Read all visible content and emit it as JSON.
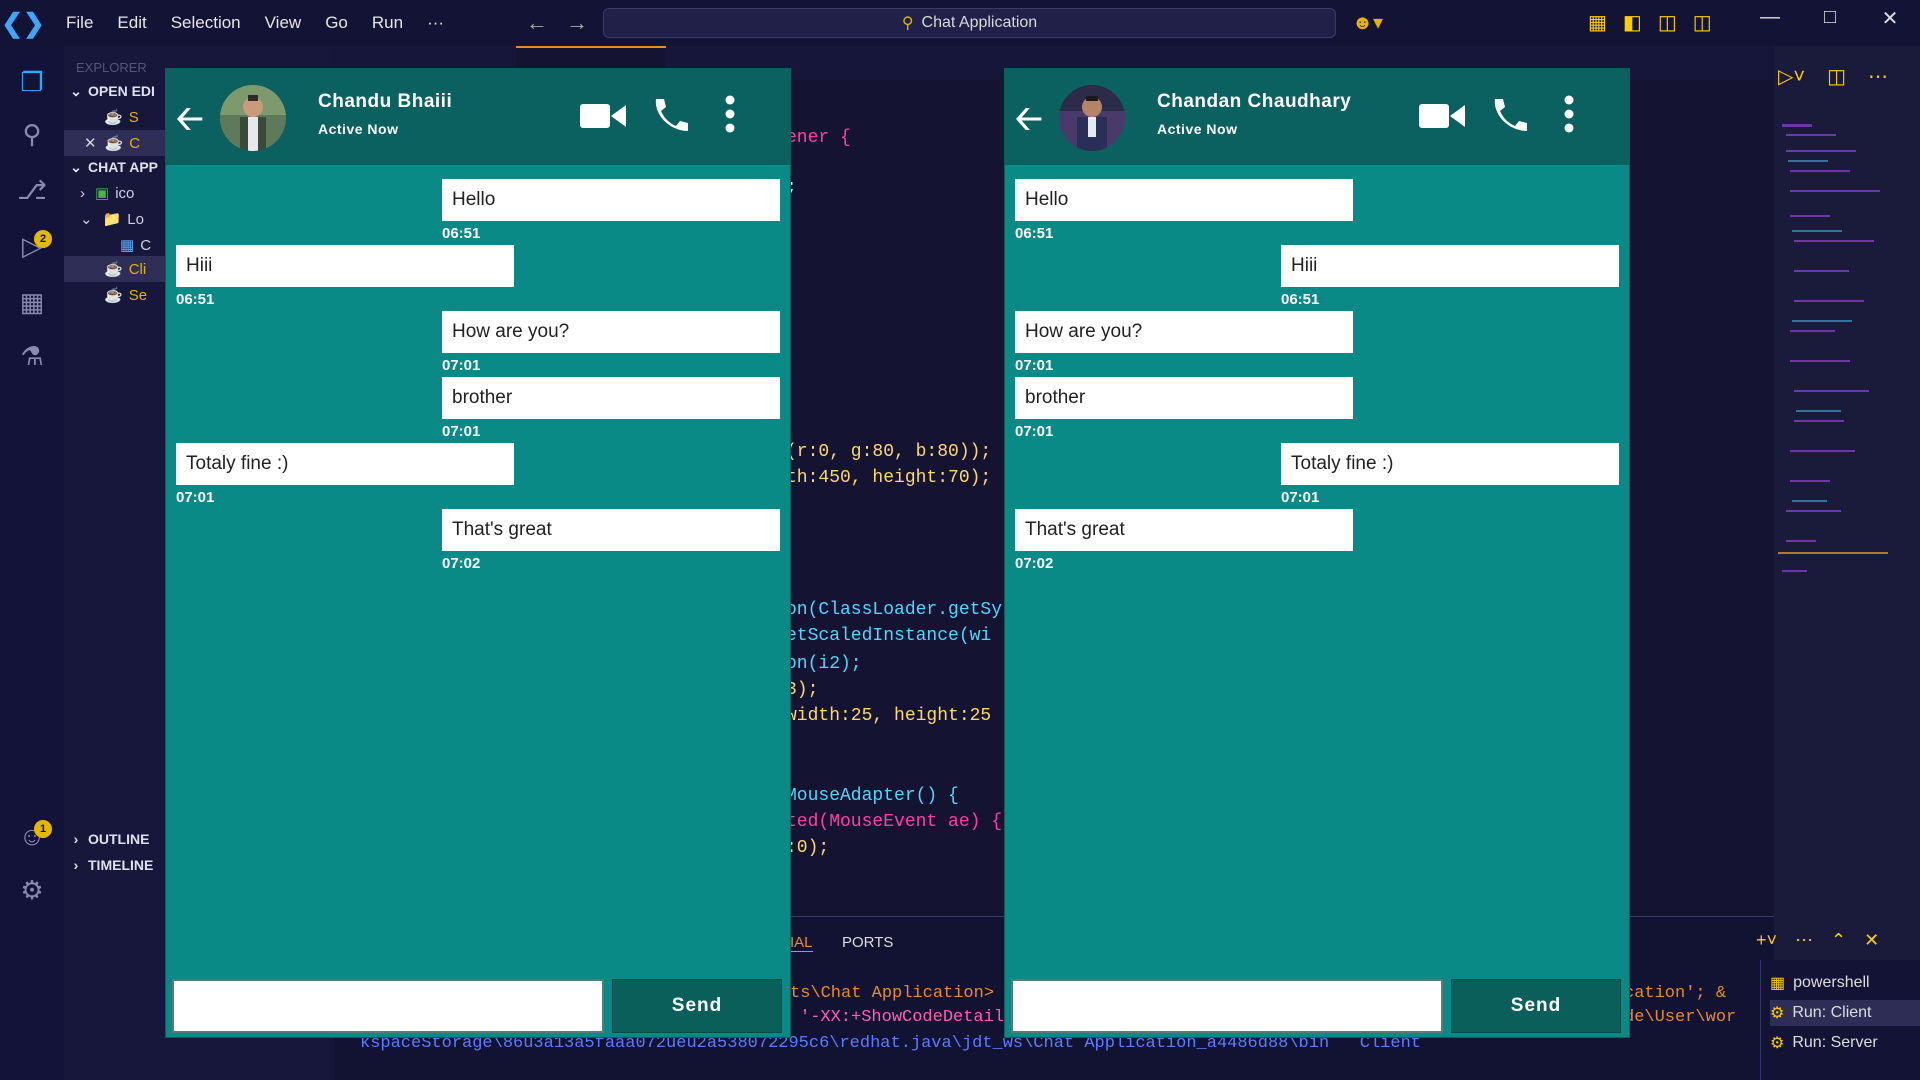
{
  "vscode": {
    "menu": [
      "File",
      "Edit",
      "Selection",
      "View",
      "Go",
      "Run",
      "···"
    ],
    "search_title": "Chat Application",
    "sidebar": {
      "explorer_label": "EXPLORER",
      "open_editors": "OPEN EDI",
      "open_editor_items": [
        "S",
        "C"
      ],
      "project": "CHAT APP",
      "tree_items": [
        "ico",
        "Lo",
        "C",
        "Cli",
        "Se"
      ],
      "outline": "OUTLINE",
      "timeline": "TIMELINE"
    },
    "badges": {
      "run_debug": "2",
      "accounts": "1"
    },
    "code_lines": [
      "ener {",
      ";",
      "(r:0, g:80, b:80));",
      "th:450, height:70);",
      "on(ClassLoader.getSy",
      "etScaledInstance(wi",
      "on(i2);",
      "3);",
      "width:25, height:25",
      "MouseAdapter() {",
      "ted(MouseEvent ae) {",
      ":0);"
    ],
    "panel_tabs": [
      "IAL",
      "PORTS"
    ],
    "terminal_lines": [
      "ts\\Chat Application>",
      "'-XX:+ShowCodeDetail",
      "kspaceStorage\\86u3a13a5faaa072ueu2a538072295c6\\redhat.java\\jdt_ws\\Chat Application_a4486d88\\bin   Client",
      "cation'; &",
      "de\\User\\wor"
    ],
    "terminals": [
      "powershell",
      "Run: Client",
      "Run: Server"
    ]
  },
  "chats": [
    {
      "name": "Chandu Bhaiii",
      "status": "Active Now",
      "send_label": "Send",
      "input_value": "",
      "messages": [
        {
          "text": "Hello",
          "time": "06:51",
          "side": "right"
        },
        {
          "text": "Hiii",
          "time": "06:51",
          "side": "left"
        },
        {
          "text": "How are you?",
          "time": "07:01",
          "side": "right"
        },
        {
          "text": "brother",
          "time": "07:01",
          "side": "right"
        },
        {
          "text": "Totaly fine :)",
          "time": "07:01",
          "side": "left"
        },
        {
          "text": "That's great",
          "time": "07:02",
          "side": "right"
        }
      ]
    },
    {
      "name": "Chandan Chaudhary",
      "status": "Active Now",
      "send_label": "Send",
      "input_value": "",
      "messages": [
        {
          "text": "Hello",
          "time": "06:51",
          "side": "left"
        },
        {
          "text": "Hiii",
          "time": "06:51",
          "side": "right"
        },
        {
          "text": "How are you?",
          "time": "07:01",
          "side": "left"
        },
        {
          "text": "brother",
          "time": "07:01",
          "side": "left"
        },
        {
          "text": "Totaly fine :)",
          "time": "07:01",
          "side": "right"
        },
        {
          "text": "That's great",
          "time": "07:02",
          "side": "left"
        }
      ]
    }
  ],
  "colors": {
    "header": "#0b6060",
    "body": "#098a87",
    "bubble": "#ffffff",
    "send_button": "#0b5f5b",
    "vscode_bg": "#141432"
  }
}
